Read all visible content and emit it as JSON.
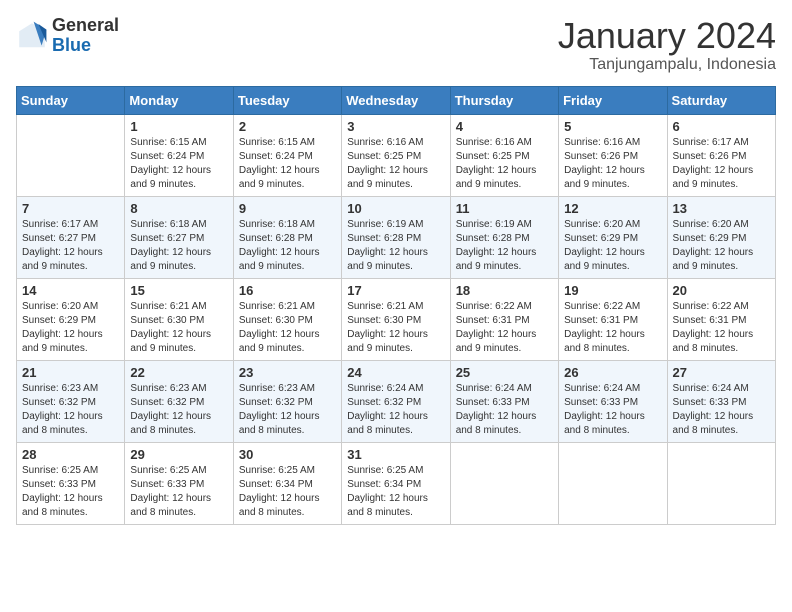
{
  "header": {
    "logo_general": "General",
    "logo_blue": "Blue",
    "month_title": "January 2024",
    "location": "Tanjungampalu, Indonesia"
  },
  "days_of_week": [
    "Sunday",
    "Monday",
    "Tuesday",
    "Wednesday",
    "Thursday",
    "Friday",
    "Saturday"
  ],
  "weeks": [
    [
      {
        "day": "",
        "empty": true
      },
      {
        "day": "1",
        "sunrise": "Sunrise: 6:15 AM",
        "sunset": "Sunset: 6:24 PM",
        "daylight": "Daylight: 12 hours and 9 minutes."
      },
      {
        "day": "2",
        "sunrise": "Sunrise: 6:15 AM",
        "sunset": "Sunset: 6:24 PM",
        "daylight": "Daylight: 12 hours and 9 minutes."
      },
      {
        "day": "3",
        "sunrise": "Sunrise: 6:16 AM",
        "sunset": "Sunset: 6:25 PM",
        "daylight": "Daylight: 12 hours and 9 minutes."
      },
      {
        "day": "4",
        "sunrise": "Sunrise: 6:16 AM",
        "sunset": "Sunset: 6:25 PM",
        "daylight": "Daylight: 12 hours and 9 minutes."
      },
      {
        "day": "5",
        "sunrise": "Sunrise: 6:16 AM",
        "sunset": "Sunset: 6:26 PM",
        "daylight": "Daylight: 12 hours and 9 minutes."
      },
      {
        "day": "6",
        "sunrise": "Sunrise: 6:17 AM",
        "sunset": "Sunset: 6:26 PM",
        "daylight": "Daylight: 12 hours and 9 minutes."
      }
    ],
    [
      {
        "day": "7",
        "sunrise": "Sunrise: 6:17 AM",
        "sunset": "Sunset: 6:27 PM",
        "daylight": "Daylight: 12 hours and 9 minutes."
      },
      {
        "day": "8",
        "sunrise": "Sunrise: 6:18 AM",
        "sunset": "Sunset: 6:27 PM",
        "daylight": "Daylight: 12 hours and 9 minutes."
      },
      {
        "day": "9",
        "sunrise": "Sunrise: 6:18 AM",
        "sunset": "Sunset: 6:28 PM",
        "daylight": "Daylight: 12 hours and 9 minutes."
      },
      {
        "day": "10",
        "sunrise": "Sunrise: 6:19 AM",
        "sunset": "Sunset: 6:28 PM",
        "daylight": "Daylight: 12 hours and 9 minutes."
      },
      {
        "day": "11",
        "sunrise": "Sunrise: 6:19 AM",
        "sunset": "Sunset: 6:28 PM",
        "daylight": "Daylight: 12 hours and 9 minutes."
      },
      {
        "day": "12",
        "sunrise": "Sunrise: 6:20 AM",
        "sunset": "Sunset: 6:29 PM",
        "daylight": "Daylight: 12 hours and 9 minutes."
      },
      {
        "day": "13",
        "sunrise": "Sunrise: 6:20 AM",
        "sunset": "Sunset: 6:29 PM",
        "daylight": "Daylight: 12 hours and 9 minutes."
      }
    ],
    [
      {
        "day": "14",
        "sunrise": "Sunrise: 6:20 AM",
        "sunset": "Sunset: 6:29 PM",
        "daylight": "Daylight: 12 hours and 9 minutes."
      },
      {
        "day": "15",
        "sunrise": "Sunrise: 6:21 AM",
        "sunset": "Sunset: 6:30 PM",
        "daylight": "Daylight: 12 hours and 9 minutes."
      },
      {
        "day": "16",
        "sunrise": "Sunrise: 6:21 AM",
        "sunset": "Sunset: 6:30 PM",
        "daylight": "Daylight: 12 hours and 9 minutes."
      },
      {
        "day": "17",
        "sunrise": "Sunrise: 6:21 AM",
        "sunset": "Sunset: 6:30 PM",
        "daylight": "Daylight: 12 hours and 9 minutes."
      },
      {
        "day": "18",
        "sunrise": "Sunrise: 6:22 AM",
        "sunset": "Sunset: 6:31 PM",
        "daylight": "Daylight: 12 hours and 9 minutes."
      },
      {
        "day": "19",
        "sunrise": "Sunrise: 6:22 AM",
        "sunset": "Sunset: 6:31 PM",
        "daylight": "Daylight: 12 hours and 8 minutes."
      },
      {
        "day": "20",
        "sunrise": "Sunrise: 6:22 AM",
        "sunset": "Sunset: 6:31 PM",
        "daylight": "Daylight: 12 hours and 8 minutes."
      }
    ],
    [
      {
        "day": "21",
        "sunrise": "Sunrise: 6:23 AM",
        "sunset": "Sunset: 6:32 PM",
        "daylight": "Daylight: 12 hours and 8 minutes."
      },
      {
        "day": "22",
        "sunrise": "Sunrise: 6:23 AM",
        "sunset": "Sunset: 6:32 PM",
        "daylight": "Daylight: 12 hours and 8 minutes."
      },
      {
        "day": "23",
        "sunrise": "Sunrise: 6:23 AM",
        "sunset": "Sunset: 6:32 PM",
        "daylight": "Daylight: 12 hours and 8 minutes."
      },
      {
        "day": "24",
        "sunrise": "Sunrise: 6:24 AM",
        "sunset": "Sunset: 6:32 PM",
        "daylight": "Daylight: 12 hours and 8 minutes."
      },
      {
        "day": "25",
        "sunrise": "Sunrise: 6:24 AM",
        "sunset": "Sunset: 6:33 PM",
        "daylight": "Daylight: 12 hours and 8 minutes."
      },
      {
        "day": "26",
        "sunrise": "Sunrise: 6:24 AM",
        "sunset": "Sunset: 6:33 PM",
        "daylight": "Daylight: 12 hours and 8 minutes."
      },
      {
        "day": "27",
        "sunrise": "Sunrise: 6:24 AM",
        "sunset": "Sunset: 6:33 PM",
        "daylight": "Daylight: 12 hours and 8 minutes."
      }
    ],
    [
      {
        "day": "28",
        "sunrise": "Sunrise: 6:25 AM",
        "sunset": "Sunset: 6:33 PM",
        "daylight": "Daylight: 12 hours and 8 minutes."
      },
      {
        "day": "29",
        "sunrise": "Sunrise: 6:25 AM",
        "sunset": "Sunset: 6:33 PM",
        "daylight": "Daylight: 12 hours and 8 minutes."
      },
      {
        "day": "30",
        "sunrise": "Sunrise: 6:25 AM",
        "sunset": "Sunset: 6:34 PM",
        "daylight": "Daylight: 12 hours and 8 minutes."
      },
      {
        "day": "31",
        "sunrise": "Sunrise: 6:25 AM",
        "sunset": "Sunset: 6:34 PM",
        "daylight": "Daylight: 12 hours and 8 minutes."
      },
      {
        "day": "",
        "empty": true
      },
      {
        "day": "",
        "empty": true
      },
      {
        "day": "",
        "empty": true
      }
    ]
  ]
}
